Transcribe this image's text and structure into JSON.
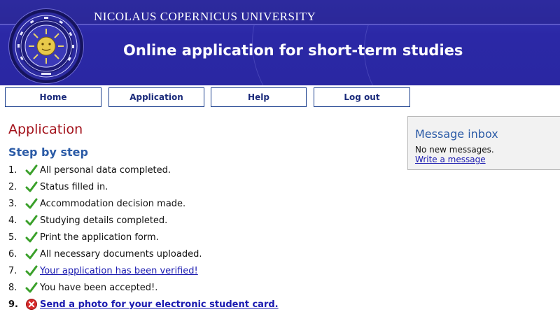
{
  "header": {
    "university": "NICOLAUS COPERNICUS UNIVERSITY",
    "title": "Online application for short-term studies",
    "seal_icon": "university-seal"
  },
  "nav": {
    "items": [
      {
        "label": "Home"
      },
      {
        "label": "Application"
      },
      {
        "label": "Help"
      },
      {
        "label": "Log out"
      }
    ]
  },
  "main": {
    "title": "Application",
    "subtitle": "Step by step",
    "steps": [
      {
        "num": "1.",
        "status": "check",
        "text": "All personal data completed.",
        "link": false
      },
      {
        "num": "2.",
        "status": "check",
        "text": "Status filled in.",
        "link": false
      },
      {
        "num": "3.",
        "status": "check",
        "text": "Accommodation decision made.",
        "link": false
      },
      {
        "num": "4.",
        "status": "check",
        "text": "Studying details completed.",
        "link": false
      },
      {
        "num": "5.",
        "status": "check",
        "text": "Print the application form.",
        "link": false
      },
      {
        "num": "6.",
        "status": "check",
        "text": "All necessary documents uploaded.",
        "link": false
      },
      {
        "num": "7.",
        "status": "check",
        "text": "Your application has been verified!",
        "link": true
      },
      {
        "num": "8.",
        "status": "check",
        "text": "You have been accepted!.",
        "link": false
      },
      {
        "num": "9.",
        "status": "error",
        "text": "Send a photo for your electronic student card.",
        "link": true
      }
    ]
  },
  "inbox": {
    "title": "Message inbox",
    "message": "No new messages.",
    "link": "Write a message"
  },
  "colors": {
    "header_blue": "#2b28a6",
    "title_red": "#a3121b",
    "heading_blue": "#2a5aa6",
    "link_blue": "#1a1ab0",
    "check_green": "#3aa02a",
    "error_red": "#d62b2b"
  }
}
